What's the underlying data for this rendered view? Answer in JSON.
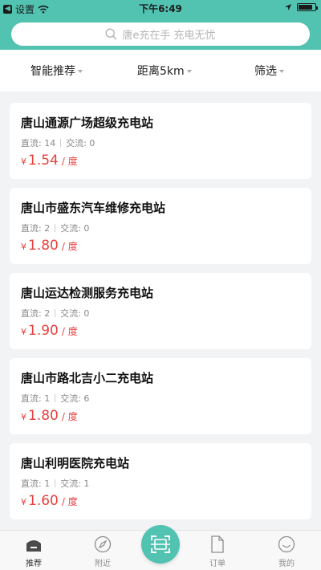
{
  "status_bar": {
    "back_label": "设置",
    "time": "下午6:49"
  },
  "search": {
    "placeholder": "唐e充在手 充电无忧"
  },
  "filters": [
    {
      "label": "智能推荐"
    },
    {
      "label": "距离5km"
    },
    {
      "label": "筛选"
    }
  ],
  "stations": [
    {
      "name": "唐山通源广场超级充电站",
      "dc_label": "直流: 14",
      "ac_label": "交流: 0",
      "currency": "¥",
      "price": "1.54",
      "unit": "/ 度"
    },
    {
      "name": "唐山市盛东汽车维修充电站",
      "dc_label": "直流: 2",
      "ac_label": "交流: 0",
      "currency": "¥",
      "price": "1.80",
      "unit": "/ 度"
    },
    {
      "name": "唐山运达检测服务充电站",
      "dc_label": "直流: 2",
      "ac_label": "交流: 0",
      "currency": "¥",
      "price": "1.90",
      "unit": "/ 度"
    },
    {
      "name": "唐山市路北吉小二充电站",
      "dc_label": "直流: 1",
      "ac_label": "交流: 6",
      "currency": "¥",
      "price": "1.80",
      "unit": "/ 度"
    },
    {
      "name": "唐山利明医院充电站",
      "dc_label": "直流: 1",
      "ac_label": "交流: 1",
      "currency": "¥",
      "price": "1.60",
      "unit": "/ 度"
    }
  ],
  "tabs": [
    {
      "label": "推荐",
      "icon": "home-icon"
    },
    {
      "label": "附近",
      "icon": "compass-icon"
    },
    {
      "label": "订单",
      "icon": "document-icon"
    },
    {
      "label": "我的",
      "icon": "smiley-icon"
    }
  ],
  "colors": {
    "brand": "#52c2b1",
    "price": "#e8403d"
  }
}
